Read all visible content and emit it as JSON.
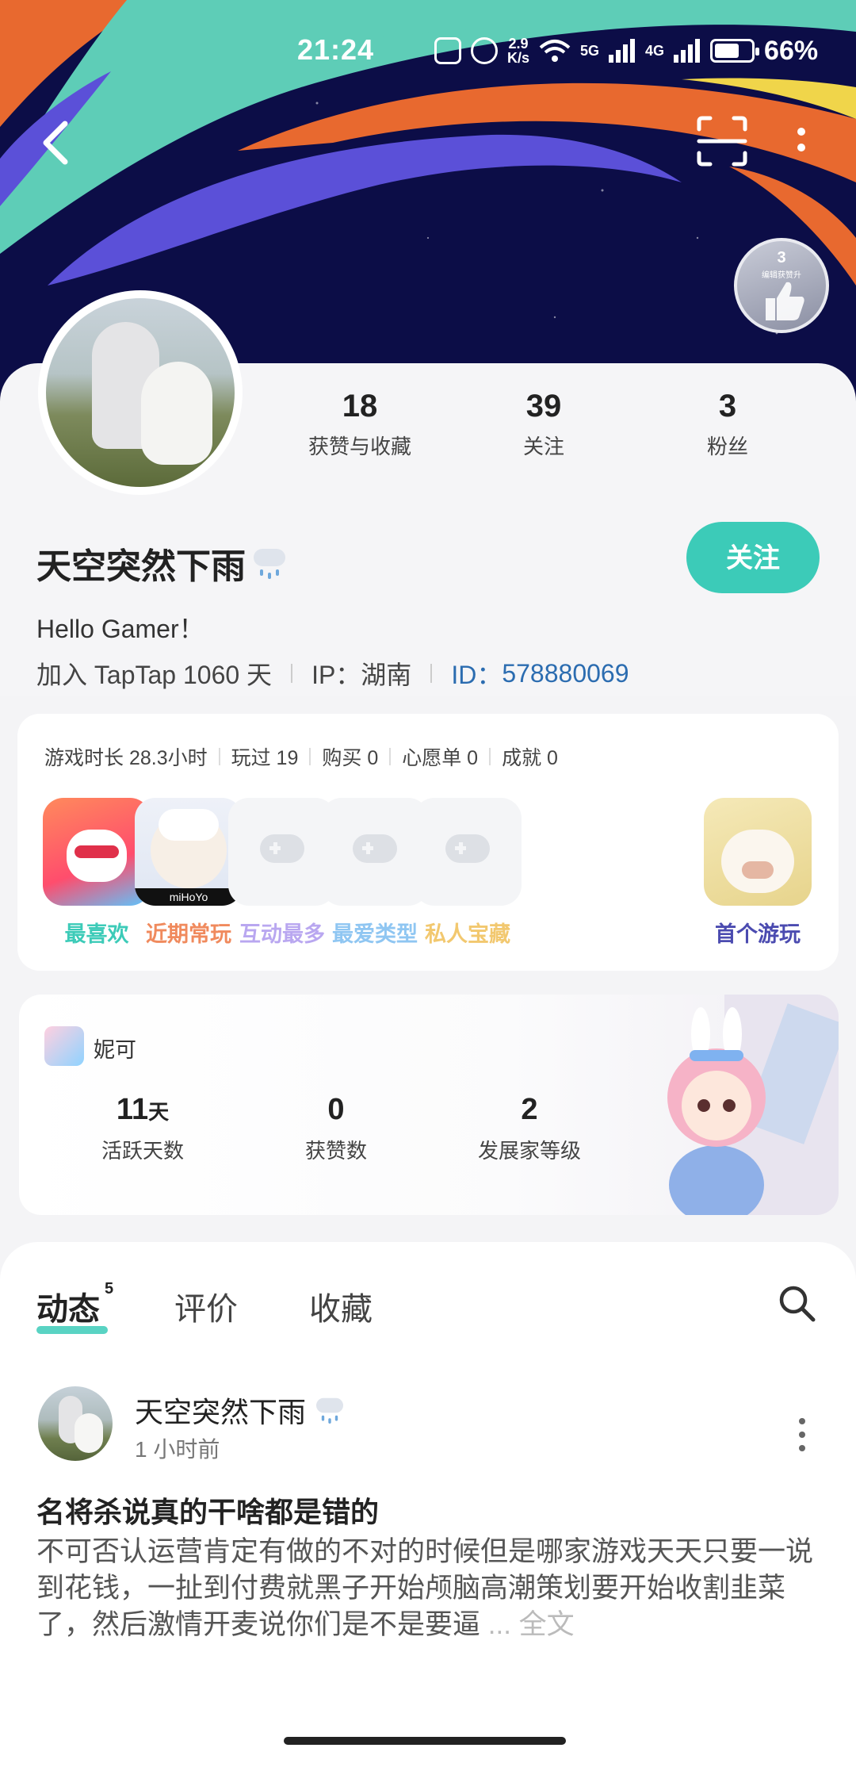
{
  "status_bar": {
    "time": "21:24",
    "net_speed_top": "2.9",
    "net_speed_bottom": "K/s",
    "signal_5g": "5G",
    "signal_4g": "4G",
    "battery": "66%"
  },
  "badge": {
    "count": "3",
    "text": "编辑获赞升"
  },
  "stats": [
    {
      "value": "18",
      "label": "获赞与收藏"
    },
    {
      "value": "39",
      "label": "关注"
    },
    {
      "value": "3",
      "label": "粉丝"
    }
  ],
  "profile": {
    "name": "天空突然下雨",
    "follow_label": "关注",
    "bio": "Hello Gamer！",
    "joined": "加入 TapTap 1060 天",
    "ip": "IP：湖南",
    "id_label": "ID：",
    "id_value": "578880069"
  },
  "games": {
    "stats": [
      "游戏时长 28.3小时",
      "玩过 19",
      "购买 0",
      "心愿单 0",
      "成就 0"
    ],
    "tiles": [
      {
        "label": "最喜欢",
        "color": "#3ccbb8",
        "icon": "game-icon-island"
      },
      {
        "label": "近期常玩",
        "color": "#f08a5d",
        "icon": "game-icon-mihoyo"
      },
      {
        "label": "互动最多",
        "color": "#b9a7f0",
        "icon": "gamepad-icon"
      },
      {
        "label": "最爱类型",
        "color": "#8fc6f2",
        "icon": "gamepad-icon"
      },
      {
        "label": "私人宝藏",
        "color": "#f2c86f",
        "icon": "gamepad-icon"
      },
      {
        "label": "首个游玩",
        "color": "#4b4bb0",
        "icon": "game-icon-boar"
      }
    ]
  },
  "nico": {
    "name": "妮可",
    "stats": [
      {
        "value": "11",
        "unit": "天",
        "label": "活跃天数"
      },
      {
        "value": "0",
        "unit": "",
        "label": "获赞数"
      },
      {
        "value": "2",
        "unit": "",
        "label": "发展家等级"
      }
    ]
  },
  "tabs": {
    "dynamic": "动态",
    "dynamic_count": "5",
    "review": "评价",
    "collect": "收藏"
  },
  "post": {
    "author": "天空突然下雨",
    "time": "1 小时前",
    "title": "名将杀说真的干啥都是错的",
    "body": "不可否认运营肯定有做的不对的时候但是哪家游戏天天只要一说到花钱，一扯到付费就黑子开始颅脑高潮策划要开始收割韭菜了，然后激情开麦说你们是不是要逼",
    "more": "... 全文"
  }
}
